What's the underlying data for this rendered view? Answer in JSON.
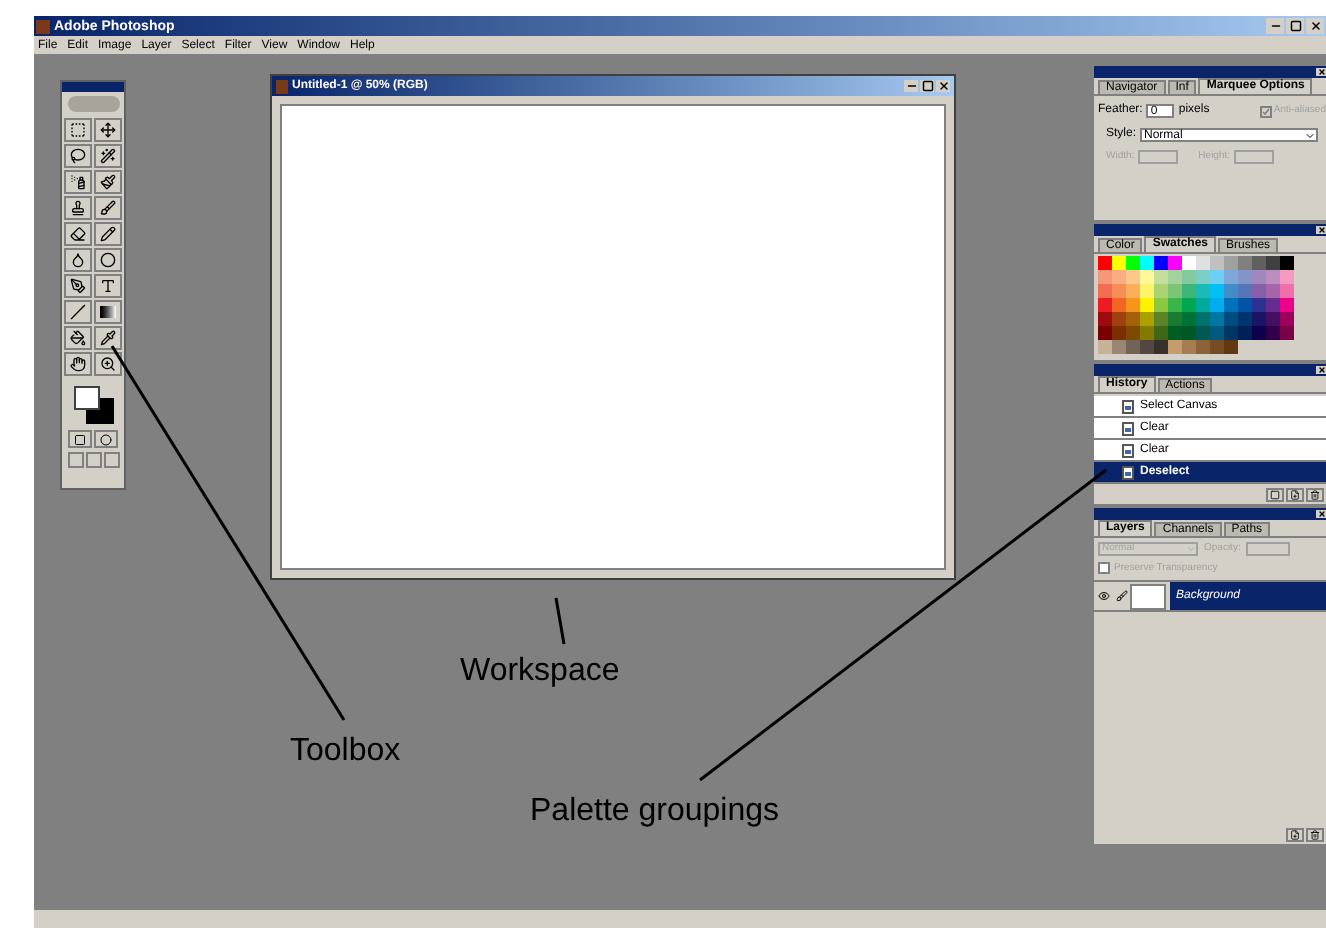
{
  "app": {
    "title": "Adobe Photoshop"
  },
  "menu": [
    "File",
    "Edit",
    "Image",
    "Layer",
    "Select",
    "Filter",
    "View",
    "Window",
    "Help"
  ],
  "document": {
    "title": "Untitled-1 @ 50% (RGB)"
  },
  "palettes": [
    {
      "kind": "options",
      "tabs": [
        {
          "label": "Navigator",
          "selected": false
        },
        {
          "label": "Inf",
          "selected": false
        },
        {
          "label": "Marquee Options",
          "selected": true
        }
      ],
      "feather_label": "Feather:",
      "feather_value": "0",
      "feather_unit": "pixels",
      "anti_aliased": {
        "label": "Anti-aliased",
        "checked": true,
        "disabled": true
      },
      "style_label": "Style:",
      "style_value": "Normal",
      "width_label": "Width:",
      "height_label": "Height:"
    },
    {
      "kind": "swatches",
      "tabs": [
        {
          "label": "Color",
          "selected": false
        },
        {
          "label": "Swatches",
          "selected": true
        },
        {
          "label": "Brushes",
          "selected": false
        }
      ],
      "swatches": [
        {
          "color": "#ff0000"
        },
        {
          "color": "#ffff00"
        },
        {
          "color": "#00ff00"
        },
        {
          "color": "#00ffff"
        },
        {
          "color": "#0000ff"
        },
        {
          "color": "#ff00ff"
        },
        {
          "color": "#ffffff"
        },
        {
          "color": "#e0e0e0"
        },
        {
          "color": "#c0c0c0"
        },
        {
          "color": "#a0a0a0"
        },
        {
          "color": "#808080"
        },
        {
          "color": "#606060"
        },
        {
          "color": "#404040"
        },
        {
          "color": "#000000"
        },
        {
          "color": "#f7977a"
        },
        {
          "color": "#f9ad81"
        },
        {
          "color": "#fdc68a"
        },
        {
          "color": "#fff79a"
        },
        {
          "color": "#c4df9b"
        },
        {
          "color": "#a2d39c"
        },
        {
          "color": "#82ca9d"
        },
        {
          "color": "#7bcdc8"
        },
        {
          "color": "#6ecff6"
        },
        {
          "color": "#7ea7d8"
        },
        {
          "color": "#8493ca"
        },
        {
          "color": "#a187be"
        },
        {
          "color": "#bc8dbf"
        },
        {
          "color": "#f49ac2"
        },
        {
          "color": "#f26c4f"
        },
        {
          "color": "#f68e55"
        },
        {
          "color": "#fbaf5c"
        },
        {
          "color": "#fff467"
        },
        {
          "color": "#acd372"
        },
        {
          "color": "#7cc576"
        },
        {
          "color": "#3bb878"
        },
        {
          "color": "#1abbb4"
        },
        {
          "color": "#00bff3"
        },
        {
          "color": "#438cca"
        },
        {
          "color": "#5574b9"
        },
        {
          "color": "#8560a8"
        },
        {
          "color": "#a864a8"
        },
        {
          "color": "#f06eaa"
        },
        {
          "color": "#ed1c24"
        },
        {
          "color": "#f26522"
        },
        {
          "color": "#f7941d"
        },
        {
          "color": "#fff200"
        },
        {
          "color": "#8dc73f"
        },
        {
          "color": "#39b54a"
        },
        {
          "color": "#00a651"
        },
        {
          "color": "#00a99d"
        },
        {
          "color": "#00aeef"
        },
        {
          "color": "#0072bc"
        },
        {
          "color": "#0054a6"
        },
        {
          "color": "#2e3192"
        },
        {
          "color": "#662d91"
        },
        {
          "color": "#ec008c"
        },
        {
          "color": "#9e0b0f"
        },
        {
          "color": "#a0410d"
        },
        {
          "color": "#a36209"
        },
        {
          "color": "#aba000"
        },
        {
          "color": "#598527"
        },
        {
          "color": "#1a7b30"
        },
        {
          "color": "#007236"
        },
        {
          "color": "#00746b"
        },
        {
          "color": "#0076a3"
        },
        {
          "color": "#004b80"
        },
        {
          "color": "#003471"
        },
        {
          "color": "#1b1464"
        },
        {
          "color": "#440e62"
        },
        {
          "color": "#9e005d"
        },
        {
          "color": "#790000"
        },
        {
          "color": "#7b2e00"
        },
        {
          "color": "#7d4900"
        },
        {
          "color": "#827b00"
        },
        {
          "color": "#406618"
        },
        {
          "color": "#005e20"
        },
        {
          "color": "#005826"
        },
        {
          "color": "#005952"
        },
        {
          "color": "#005b7f"
        },
        {
          "color": "#003663"
        },
        {
          "color": "#002157"
        },
        {
          "color": "#0d004c"
        },
        {
          "color": "#32004b"
        },
        {
          "color": "#7b0046"
        },
        {
          "color": "#c7b299"
        },
        {
          "color": "#998675"
        },
        {
          "color": "#736357"
        },
        {
          "color": "#534741"
        },
        {
          "color": "#37302d"
        },
        {
          "color": "#c69c6d"
        },
        {
          "color": "#a67c52"
        },
        {
          "color": "#8c6239"
        },
        {
          "color": "#754c24"
        },
        {
          "color": "#603913"
        }
      ]
    },
    {
      "kind": "history",
      "tabs": [
        {
          "label": "History",
          "selected": true
        },
        {
          "label": "Actions",
          "selected": false
        }
      ],
      "items": [
        {
          "label": "Select Canvas",
          "selected": false
        },
        {
          "label": "Clear",
          "selected": false
        },
        {
          "label": "Clear",
          "selected": false
        },
        {
          "label": "Deselect",
          "selected": true
        }
      ]
    },
    {
      "kind": "layers",
      "tabs": [
        {
          "label": "Layers",
          "selected": true
        },
        {
          "label": "Channels",
          "selected": false
        },
        {
          "label": "Paths",
          "selected": false
        }
      ],
      "blend_mode": "Normal",
      "opacity_label": "Opacity:",
      "preserve_transparency": {
        "label": "Preserve Transparency",
        "checked": false
      },
      "layers": [
        {
          "name": "Background",
          "selected": true,
          "visible": true
        }
      ]
    }
  ],
  "annotations": [
    {
      "text": "Workspace"
    },
    {
      "text": "Toolbox"
    },
    {
      "text": "Palette groupings"
    }
  ]
}
